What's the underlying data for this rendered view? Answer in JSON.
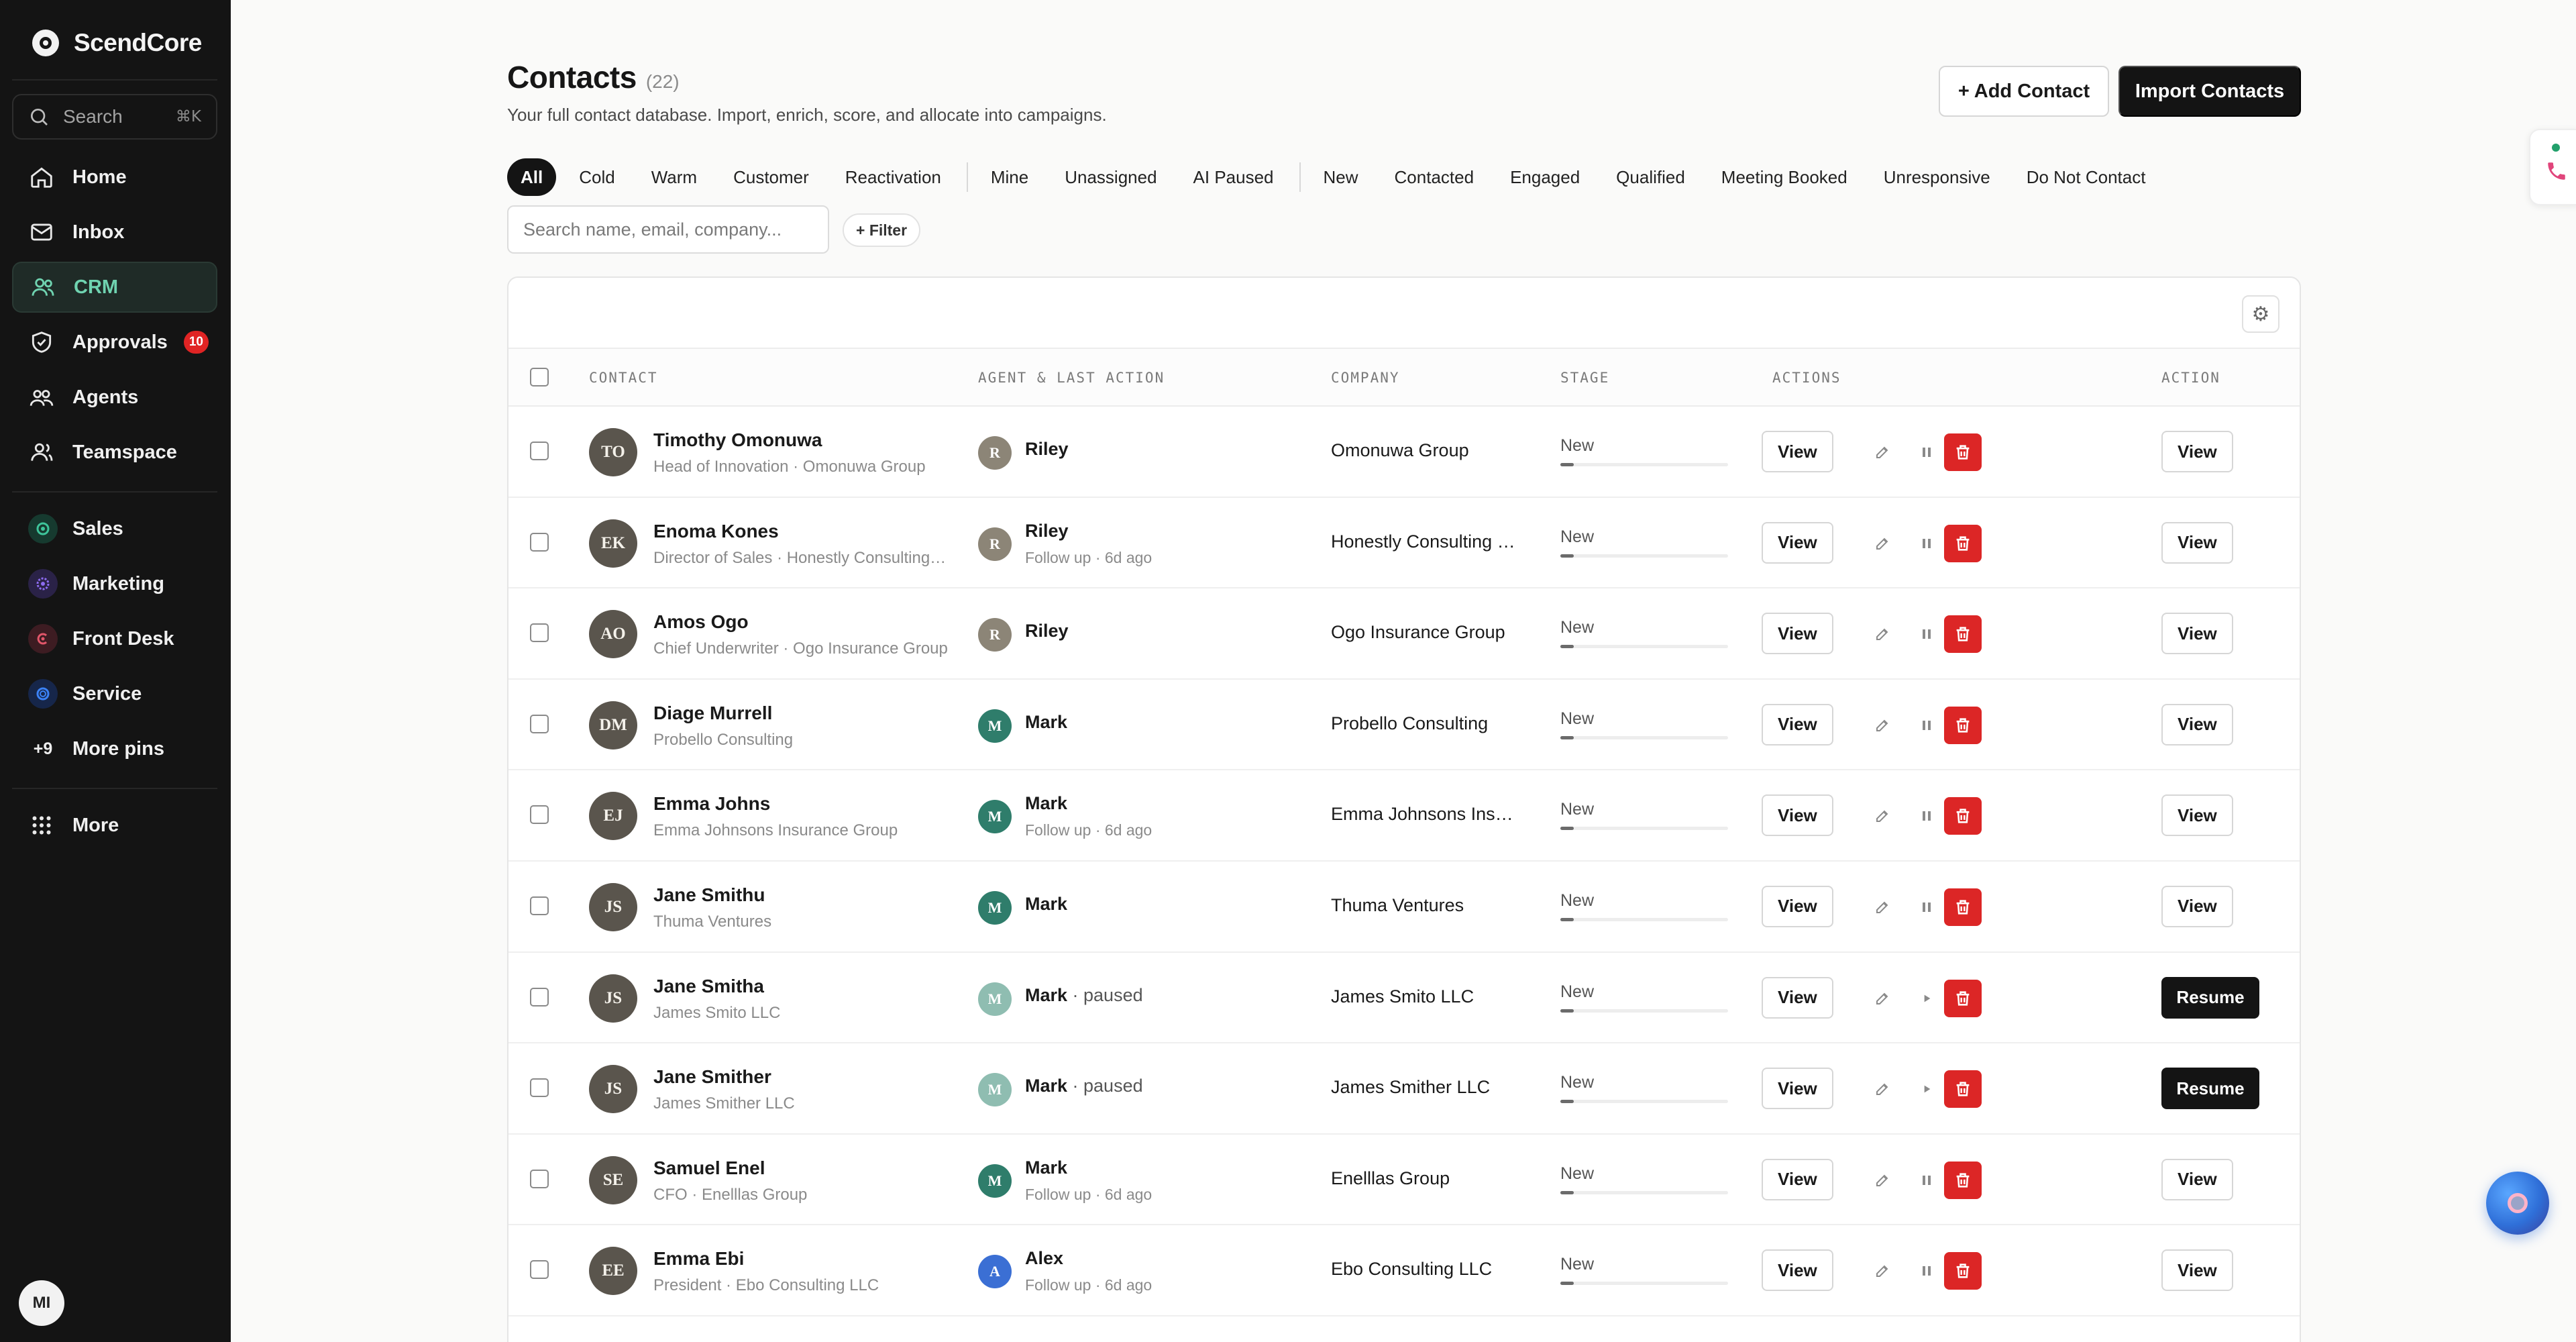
{
  "app": {
    "brand": "ScendCore"
  },
  "sidebar": {
    "search": {
      "label": "Search",
      "shortcut": "⌘K"
    },
    "nav": [
      {
        "label": "Home",
        "icon": "home-icon"
      },
      {
        "label": "Inbox",
        "icon": "inbox-icon"
      },
      {
        "label": "CRM",
        "icon": "users-icon",
        "active": true
      },
      {
        "label": "Approvals",
        "icon": "shield-check-icon",
        "badge": "10"
      },
      {
        "label": "Agents",
        "icon": "agents-icon"
      },
      {
        "label": "Teamspace",
        "icon": "team-icon"
      }
    ],
    "pins": [
      {
        "label": "Sales",
        "icon": "sales-icon",
        "color": "#1f7a5c"
      },
      {
        "label": "Marketing",
        "icon": "marketing-icon",
        "color": "#6b4fd8"
      },
      {
        "label": "Front Desk",
        "icon": "front-desk-icon",
        "color": "#d8455a"
      },
      {
        "label": "Service",
        "icon": "service-icon",
        "color": "#2f6fd8"
      }
    ],
    "more_pins": {
      "count": "+9",
      "label": "More pins"
    },
    "more": {
      "label": "More"
    },
    "user_initials": "MI"
  },
  "header": {
    "title": "Contacts",
    "count": "(22)",
    "subtitle": "Your full contact database. Import, enrich, score, and allocate into campaigns.",
    "add_button": "+ Add Contact",
    "import_button": "Import Contacts"
  },
  "filters": {
    "groups": [
      [
        "All",
        "Cold",
        "Warm",
        "Customer",
        "Reactivation"
      ],
      [
        "Mine",
        "Unassigned",
        "AI Paused"
      ],
      [
        "New",
        "Contacted",
        "Engaged",
        "Qualified",
        "Meeting Booked",
        "Unresponsive",
        "Do Not Contact"
      ]
    ],
    "active": "All",
    "search_placeholder": "Search name, email, company...",
    "filter_button": "+ Filter"
  },
  "table": {
    "columns": {
      "contact": "CONTACT",
      "agent": "AGENT & LAST ACTION",
      "company": "COMPANY",
      "stage": "STAGE",
      "actions": "ACTIONS",
      "action": "ACTION"
    },
    "rows": [
      {
        "initials": "TO",
        "name": "Timothy Omonuwa",
        "role": "Head of Innovation · Omonuwa Group",
        "agent_initial": "R",
        "agent": "Riley",
        "agent_color": "#8c8577",
        "paused": false,
        "last_action": "",
        "company": "Omonuwa Group",
        "stage": "New",
        "stage_progress": 0.08,
        "action": "View"
      },
      {
        "initials": "EK",
        "name": "Enoma Kones",
        "role": "Director of Sales · Honestly Consulting Group",
        "agent_initial": "R",
        "agent": "Riley",
        "agent_color": "#8c8577",
        "paused": false,
        "last_action": "Follow up · 6d ago",
        "company": "Honestly Consulting Group",
        "stage": "New",
        "stage_progress": 0.08,
        "action": "View"
      },
      {
        "initials": "AO",
        "name": "Amos Ogo",
        "role": "Chief Underwriter · Ogo Insurance Group",
        "agent_initial": "R",
        "agent": "Riley",
        "agent_color": "#8c8577",
        "paused": false,
        "last_action": "",
        "company": "Ogo Insurance Group",
        "stage": "New",
        "stage_progress": 0.08,
        "action": "View"
      },
      {
        "initials": "DM",
        "name": "Diage Murrell",
        "role": "Probello Consulting",
        "agent_initial": "M",
        "agent": "Mark",
        "agent_color": "#2f7d6b",
        "paused": false,
        "last_action": "",
        "company": "Probello Consulting",
        "stage": "New",
        "stage_progress": 0.08,
        "action": "View"
      },
      {
        "initials": "EJ",
        "name": "Emma Johns",
        "role": "Emma Johnsons Insurance Group",
        "agent_initial": "M",
        "agent": "Mark",
        "agent_color": "#2f7d6b",
        "paused": false,
        "last_action": "Follow up · 6d ago",
        "company": "Emma Johnsons Insurance Group",
        "stage": "New",
        "stage_progress": 0.08,
        "action": "View"
      },
      {
        "initials": "JS",
        "name": "Jane Smithu",
        "role": "Thuma Ventures",
        "agent_initial": "M",
        "agent": "Mark",
        "agent_color": "#2f7d6b",
        "paused": false,
        "last_action": "",
        "company": "Thuma Ventures",
        "stage": "New",
        "stage_progress": 0.08,
        "action": "View"
      },
      {
        "initials": "JS",
        "name": "Jane Smitha",
        "role": "James Smito LLC",
        "agent_initial": "M",
        "agent": "Mark",
        "agent_color": "#8fbdb1",
        "paused": true,
        "paused_label": " · paused",
        "last_action": "",
        "company": "James Smito LLC",
        "stage": "New",
        "stage_progress": 0.08,
        "action": "Resume"
      },
      {
        "initials": "JS",
        "name": "Jane Smither",
        "role": "James Smither LLC",
        "agent_initial": "M",
        "agent": "Mark",
        "agent_color": "#8fbdb1",
        "paused": true,
        "paused_label": " · paused",
        "last_action": "",
        "company": "James Smither LLC",
        "stage": "New",
        "stage_progress": 0.08,
        "action": "Resume"
      },
      {
        "initials": "SE",
        "name": "Samuel Enel",
        "role": "CFO · Enelllas Group",
        "agent_initial": "M",
        "agent": "Mark",
        "agent_color": "#2f7d6b",
        "paused": false,
        "last_action": "Follow up · 6d ago",
        "company": "Enelllas Group",
        "stage": "New",
        "stage_progress": 0.08,
        "action": "View"
      },
      {
        "initials": "EE",
        "name": "Emma Ebi",
        "role": "President · Ebo Consulting LLC",
        "agent_initial": "A",
        "agent": "Alex",
        "agent_color": "#3b6fd4",
        "paused": false,
        "last_action": "Follow up · 6d ago",
        "company": "Ebo Consulting LLC",
        "stage": "New",
        "stage_progress": 0.08,
        "action": "View"
      }
    ],
    "view_label": "View"
  },
  "colors": {
    "accent_green": "#6fd3b0",
    "danger": "#dc2626",
    "sidebar_bg": "#141414"
  }
}
